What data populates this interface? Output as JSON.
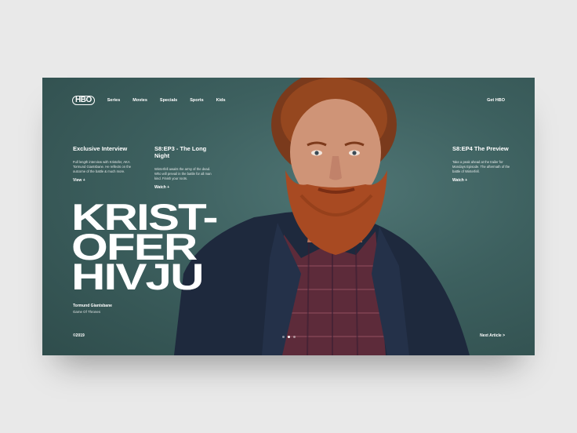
{
  "nav": {
    "logo": "HBO",
    "items": [
      "Series",
      "Movies",
      "Specials",
      "Sports",
      "Kids"
    ],
    "right": "Get HBO"
  },
  "columns": [
    {
      "title": "Exclusive Interview",
      "text": "Full length interview with Kristofer, AKA Tormund Giantsbane. He reflects on the outcome of the battle & much more.",
      "link": "View +"
    },
    {
      "title": "S8:EP3 - The Long Night",
      "text": "Winterfell awaits the army of the dead. Who will prevail in the battle for all man kind. Finish your roots.",
      "link": "Watch +"
    },
    {
      "title": "S8:EP4 The Preview",
      "text": "Take a peak ahead at the trailer for Mondays Episode. The aftermath of the battle of Winterfell.",
      "link": "Watch +"
    }
  ],
  "hero": {
    "lines": [
      "KRIST-",
      "OFER",
      "HIVJU"
    ]
  },
  "subtitle": {
    "name": "Tormund Giantsbane",
    "show": "Game Of Thrones"
  },
  "footer": {
    "copyright": "©2019",
    "next": "Next Article >"
  },
  "slider": {
    "count": 3,
    "active_index": 1
  },
  "colors": {
    "background": "#e9e9e9",
    "card": "#3d605f",
    "beard": "#a84a22",
    "jacket": "#1f2a3f",
    "shirt": "#6b2f3c"
  }
}
